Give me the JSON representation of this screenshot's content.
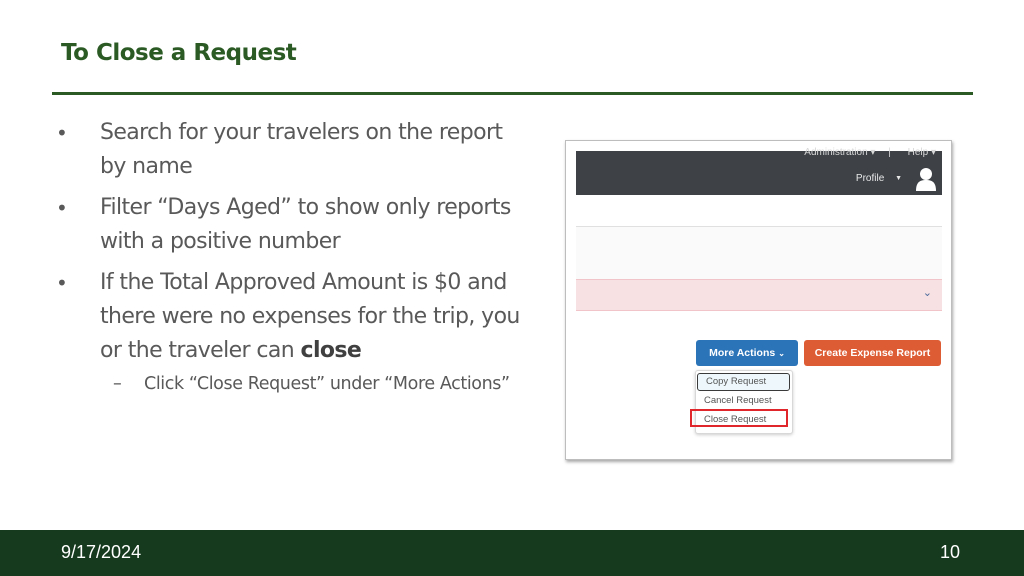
{
  "slide": {
    "title": "To Close a Request",
    "bullets": [
      {
        "text": "Search for your travelers on the report by name"
      },
      {
        "text": "Filter “Days Aged” to show only reports with a positive number"
      },
      {
        "text_before": "If the Total Approved Amount is $0 and there were no expenses for the trip, you or the traveler can ",
        "bold": "close"
      }
    ],
    "sub_bullet": "Click “Close Request” under “More Actions”",
    "bullet_glyph": "•",
    "dash_glyph": "–"
  },
  "screenshot": {
    "topbar": {
      "administration": "Administration ▾",
      "separator": "|",
      "help": "Help ▾",
      "profile": "Profile",
      "profile_caret": "▼",
      "avatar_icon": "user-icon"
    },
    "alert_chevron": "⌄",
    "more_actions": "More Actions",
    "more_actions_chevron": "⌄",
    "create_expense_report": "Create Expense Report",
    "menu": [
      "Copy Request",
      "Cancel Request",
      "Close Request"
    ],
    "highlighted_item": "Close Request",
    "colors": {
      "more_actions_bg": "#2c74b8",
      "create_bg": "#dd5c34",
      "highlight": "#e0262a",
      "alert_bg": "#f8e1e3",
      "topbar_bg": "#3e4247"
    }
  },
  "footer": {
    "date": "9/17/2024",
    "page_number": "10"
  },
  "theme": {
    "accent": "#2b5a24",
    "footer_bg": "#163a1e"
  }
}
